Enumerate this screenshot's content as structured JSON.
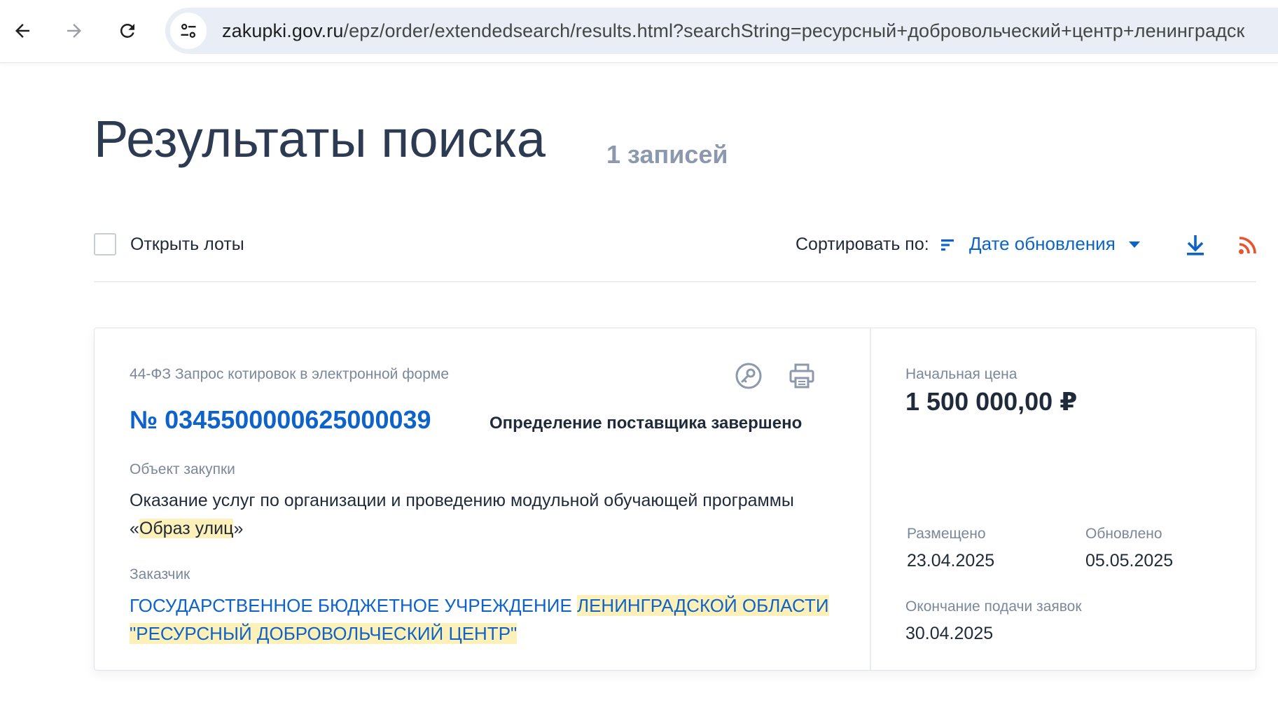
{
  "browser": {
    "url_host": "zakupki.gov.ru",
    "url_path": "/epz/order/extendedsearch/results.html?searchString=ресурсный+добровольческий+центр+ленинградск"
  },
  "header": {
    "title": "Результаты поиска",
    "records_count": "1 записей"
  },
  "toolbar": {
    "open_lots_label": "Открыть лоты",
    "open_lots_checked": false,
    "sort_label": "Сортировать по:",
    "sort_value": "Дате обновления"
  },
  "result": {
    "law_type": "44-ФЗ Запрос котировок в электронной форме",
    "reg_number": "№ 0345500000625000039",
    "status": "Определение поставщика завершено",
    "object_label": "Объект закупки",
    "object_text_before": "Оказание услуг по организации и проведению модульной обучающей программы «",
    "object_text_highlight": "Образ улиц",
    "object_text_after": "»",
    "customer_label": "Заказчик",
    "customer_text_before": "ГОСУДАРСТВЕННОЕ БЮДЖЕТНОЕ УЧРЕЖДЕНИЕ ",
    "customer_text_highlight": "ЛЕНИНГРАДСКОЙ ОБЛАСТИ \"РЕСУРСНЫЙ ДОБРОВОЛЬЧЕСКИЙ ЦЕНТР\"",
    "price_label": "Начальная цена",
    "price_value": "1 500 000,00 ₽",
    "posted_label": "Размещено",
    "posted_value": "23.04.2025",
    "updated_label": "Обновлено",
    "updated_value": "05.05.2025",
    "deadline_label": "Окончание подачи заявок",
    "deadline_value": "30.04.2025"
  },
  "colors": {
    "accent_blue": "#0d63c9",
    "highlight": "#fdf0b8",
    "rss_orange": "#e8542e",
    "muted_text": "#7b879a"
  }
}
